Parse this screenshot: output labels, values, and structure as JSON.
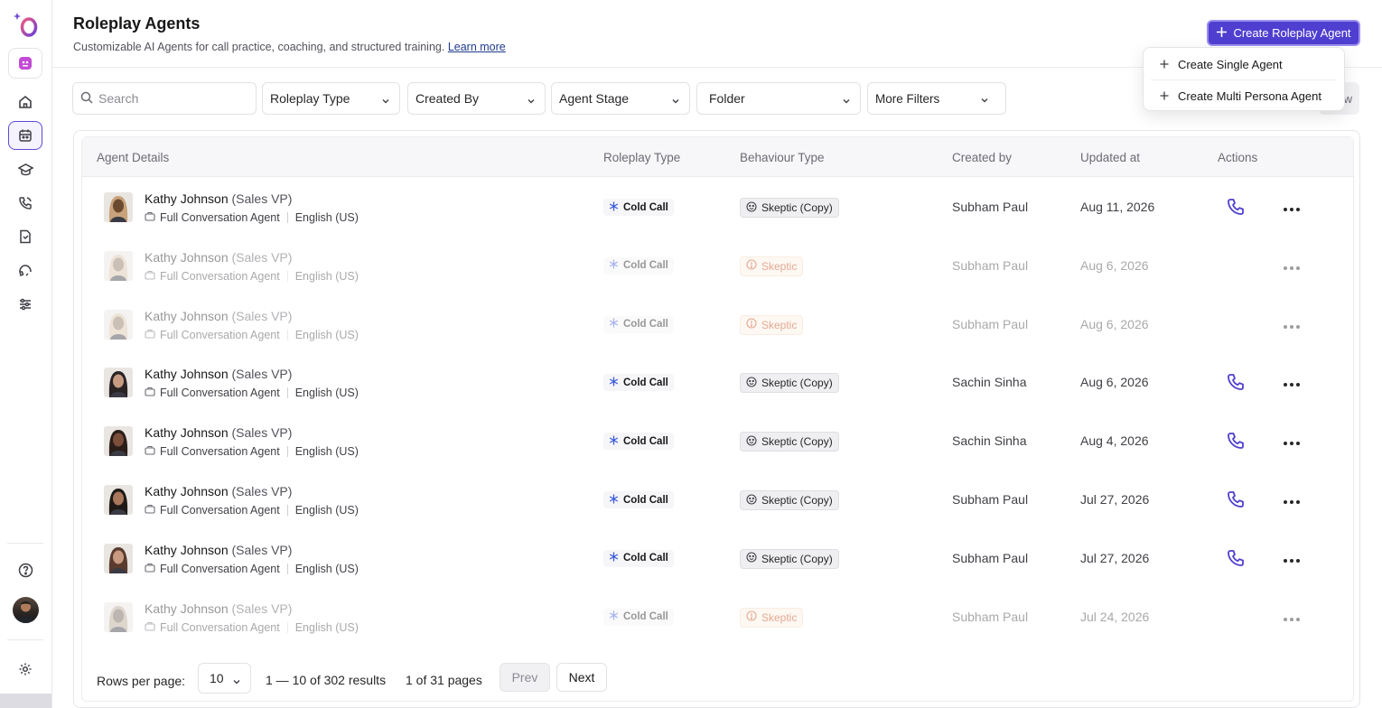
{
  "header": {
    "title": "Roleplay Agents",
    "subtitle": "Customizable AI Agents for call practice, coaching, and structured training.",
    "learn_more": "Learn more",
    "create_button": "Create Roleplay Agent"
  },
  "create_menu": {
    "items": [
      "Create Single Agent",
      "Create Multi Persona Agent"
    ]
  },
  "filters": {
    "search_placeholder": "Search",
    "roleplay_type": "Roleplay Type",
    "created_by": "Created By",
    "agent_stage": "Agent Stage",
    "folder": "Folder",
    "more_filters": "More Filters",
    "view_partial": "w"
  },
  "table": {
    "headers": {
      "agent_details": "Agent Details",
      "roleplay_type": "Roleplay Type",
      "behaviour_type": "Behaviour Type",
      "created_by": "Created by",
      "updated_at": "Updated at",
      "actions": "Actions"
    },
    "rows": [
      {
        "name": "Kathy Johnson",
        "role": "(Sales VP)",
        "agent_type": "Full Conversation Agent",
        "language": "English (US)",
        "roleplay": "Cold Call",
        "behaviour": "Skeptic (Copy)",
        "created_by": "Subham Paul",
        "updated": "Aug 11, 2026"
      },
      {
        "name": "Kathy Johnson",
        "role": "(Sales VP)",
        "agent_type": "Full Conversation Agent",
        "language": "English (US)",
        "roleplay": "Cold Call",
        "behaviour": "Skeptic",
        "created_by": "Subham Paul",
        "updated": "Aug 6, 2026"
      },
      {
        "name": "Kathy Johnson",
        "role": "(Sales VP)",
        "agent_type": "Full Conversation Agent",
        "language": "English (US)",
        "roleplay": "Cold Call",
        "behaviour": "Skeptic",
        "created_by": "Subham Paul",
        "updated": "Aug 6, 2026"
      },
      {
        "name": "Kathy Johnson",
        "role": "(Sales VP)",
        "agent_type": "Full Conversation Agent",
        "language": "English (US)",
        "roleplay": "Cold Call",
        "behaviour": "Skeptic (Copy)",
        "created_by": "Sachin Sinha",
        "updated": "Aug 6, 2026"
      },
      {
        "name": "Kathy Johnson",
        "role": "(Sales VP)",
        "agent_type": "Full Conversation Agent",
        "language": "English (US)",
        "roleplay": "Cold Call",
        "behaviour": "Skeptic (Copy)",
        "created_by": "Sachin Sinha",
        "updated": "Aug 4, 2026"
      },
      {
        "name": "Kathy Johnson",
        "role": "(Sales VP)",
        "agent_type": "Full Conversation Agent",
        "language": "English (US)",
        "roleplay": "Cold Call",
        "behaviour": "Skeptic (Copy)",
        "created_by": "Subham Paul",
        "updated": "Jul 27, 2026"
      },
      {
        "name": "Kathy Johnson",
        "role": "(Sales VP)",
        "agent_type": "Full Conversation Agent",
        "language": "English (US)",
        "roleplay": "Cold Call",
        "behaviour": "Skeptic (Copy)",
        "created_by": "Subham Paul",
        "updated": "Jul 27, 2026"
      },
      {
        "name": "Kathy Johnson",
        "role": "(Sales VP)",
        "agent_type": "Full Conversation Agent",
        "language": "English (US)",
        "roleplay": "Cold Call",
        "behaviour": "Skeptic",
        "created_by": "Subham Paul",
        "updated": "Jul 24, 2026"
      }
    ]
  },
  "pagination": {
    "rows_label": "Rows per page:",
    "rows_value": "10",
    "results": "1 — 10 of 302 results",
    "pages": "1 of 31 pages",
    "prev": "Prev",
    "next": "Next"
  },
  "colors": {
    "accent": "#4f3fd0",
    "warn": "#c2410c"
  },
  "icons": [
    "logo-icon",
    "app-icon",
    "home-icon",
    "calendar-icon",
    "learning-icon",
    "phone-call-icon",
    "document-icon",
    "headset-icon",
    "sliders-icon",
    "help-icon",
    "settings-icon",
    "plus-icon",
    "search-icon",
    "chevron-down-icon",
    "phone-icon",
    "more-icon",
    "briefcase-icon",
    "snowflake-icon",
    "smile-icon",
    "warning-icon"
  ]
}
